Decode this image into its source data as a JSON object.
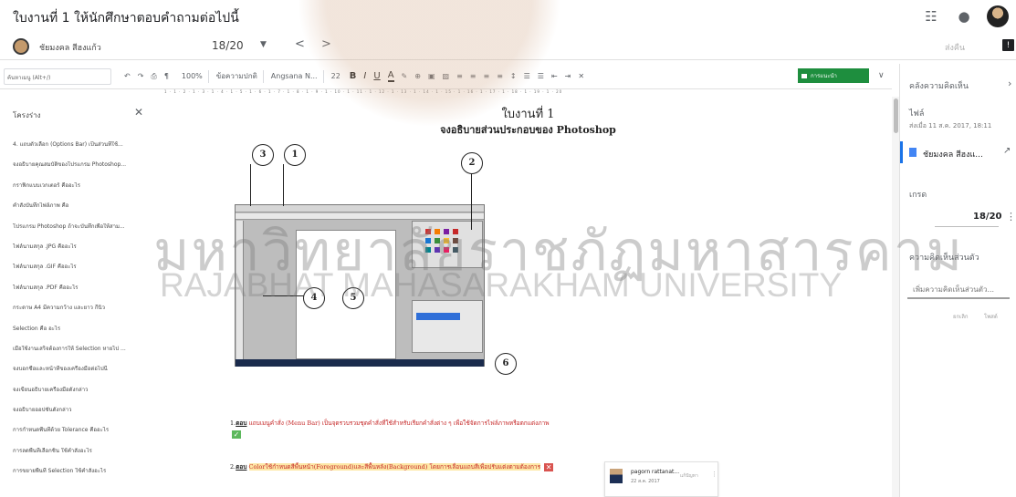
{
  "app": {
    "doc_title": "ใบงานที่ 1 ให้นักศึกษาตอบคำถามต่อไปนี้"
  },
  "student_bar": {
    "name": "ชัยมงคล สีฮงแก้ว",
    "count": "18/20",
    "return_label": "ส่งคืน",
    "nav_prev": "<",
    "nav_next": ">"
  },
  "toolbar": {
    "search_placeholder": "ค้นหาเมนู (Alt+/)",
    "zoom": "100%",
    "style": "ข้อความปกติ",
    "font": "Angsana N...",
    "font_size": "22",
    "bold": "B",
    "italic": "I",
    "underline": "U",
    "color": "A",
    "suggest_mode": "การแนะนำ"
  },
  "outline": {
    "header": "โครงร่าง",
    "items": [
      "4. แถบตัวเลือก (Options Bar) เป็นส่วนที่ใช้...",
      "จงอธิบายคุณสมบัติของโปรแกรม Photoshop...",
      "กราฟิกแบบเวกเตอร์ คืออะไร",
      "คำสั่งบันทึกไฟล์ภาพ คือ",
      "โปรแกรม Photoshop ถ้าจะบันทึกเพื่อให้สาม...",
      "ไฟล์นามสกุล .JPG คืออะไร",
      "ไฟล์นามสกุล .GIF คืออะไร",
      "ไฟล์นามสกุล .PDF คืออะไร",
      "กระดาษ A4 มีความกว้าง และยาว กี่นิ้ว",
      "Selection คือ อะไร",
      "เมื่อใช้งานเสร็จต้องการให้ Selection หายไป ...",
      "จงบอกชื่อและหน้าที่ของเครื่องมือต่อไปนี้",
      "จงเขียนอธิบายเครื่องมือดังกล่าว",
      "จงอธิบายออปชั่นดังกล่าว",
      "การกำหนดพื้นที่ด้วย Tolerance คืออะไร",
      "การลดพื้นที่เลือกชิ้น ใช้คำสั่งอะไร",
      "การขยายพื้นที่ Selection ใช้คำสั่งอะไร"
    ]
  },
  "document": {
    "title": "ใบงานที่ 1",
    "subtitle": "จงอธิบายส่วนประกอบของ Photoshop",
    "callouts": [
      "1",
      "2",
      "3",
      "4",
      "5",
      "6"
    ],
    "answer1_label": "ตอบ",
    "answer1_prefix": "1.",
    "answer1_text": "แถบเมนูคำสั่ง (Menu Bar) เป็นจุดรวบรวมชุดคำสั่งที่ใช้สำหรับเรียกคำสั่งต่าง ๆ เพื่อใช้จัดการไฟล์ภาพหรือตกแต่งภาพ",
    "answer2_prefix": "2.",
    "answer2_label": "ตอบ",
    "answer2_text": "Colorใช้กำหนดสีพื้นหน้า(Foreground)และสีพื้นหลัง(Background) โดยการเลื่อนแถบสีเพื่อปรับแต่งตามต้องการ"
  },
  "comment": {
    "author": "pagorn rattanat...",
    "date": "22 ส.ค. 2017",
    "resolve": "แก้ปัญหา"
  },
  "right_panel": {
    "title": "คลังความคิดเห็น",
    "files_label": "ไฟล์",
    "sent": "ส่งเมื่อ 11 ส.ค. 2017, 18:11",
    "file_name": "ชัยมงคล สีฮงแ...",
    "grade_label": "เกรด",
    "grade": "18/20",
    "private_label": "ความคิดเห็นส่วนตัว",
    "private_placeholder": "เพิ่มความคิดเห็นส่วนตัว...",
    "cancel": "ยกเลิก",
    "post": "โพสต์"
  },
  "watermark": {
    "thai": "มหาวิทยาลัยราชภัฏมหาสารคาม",
    "english": "RAJABHAT MAHASARAKHAM UNIVERSITY"
  },
  "colors": {
    "accent": "#1a73e8",
    "suggest_green": "#1e8e3e",
    "answer_red": "#c62828",
    "highlight": "#fde8a6"
  }
}
